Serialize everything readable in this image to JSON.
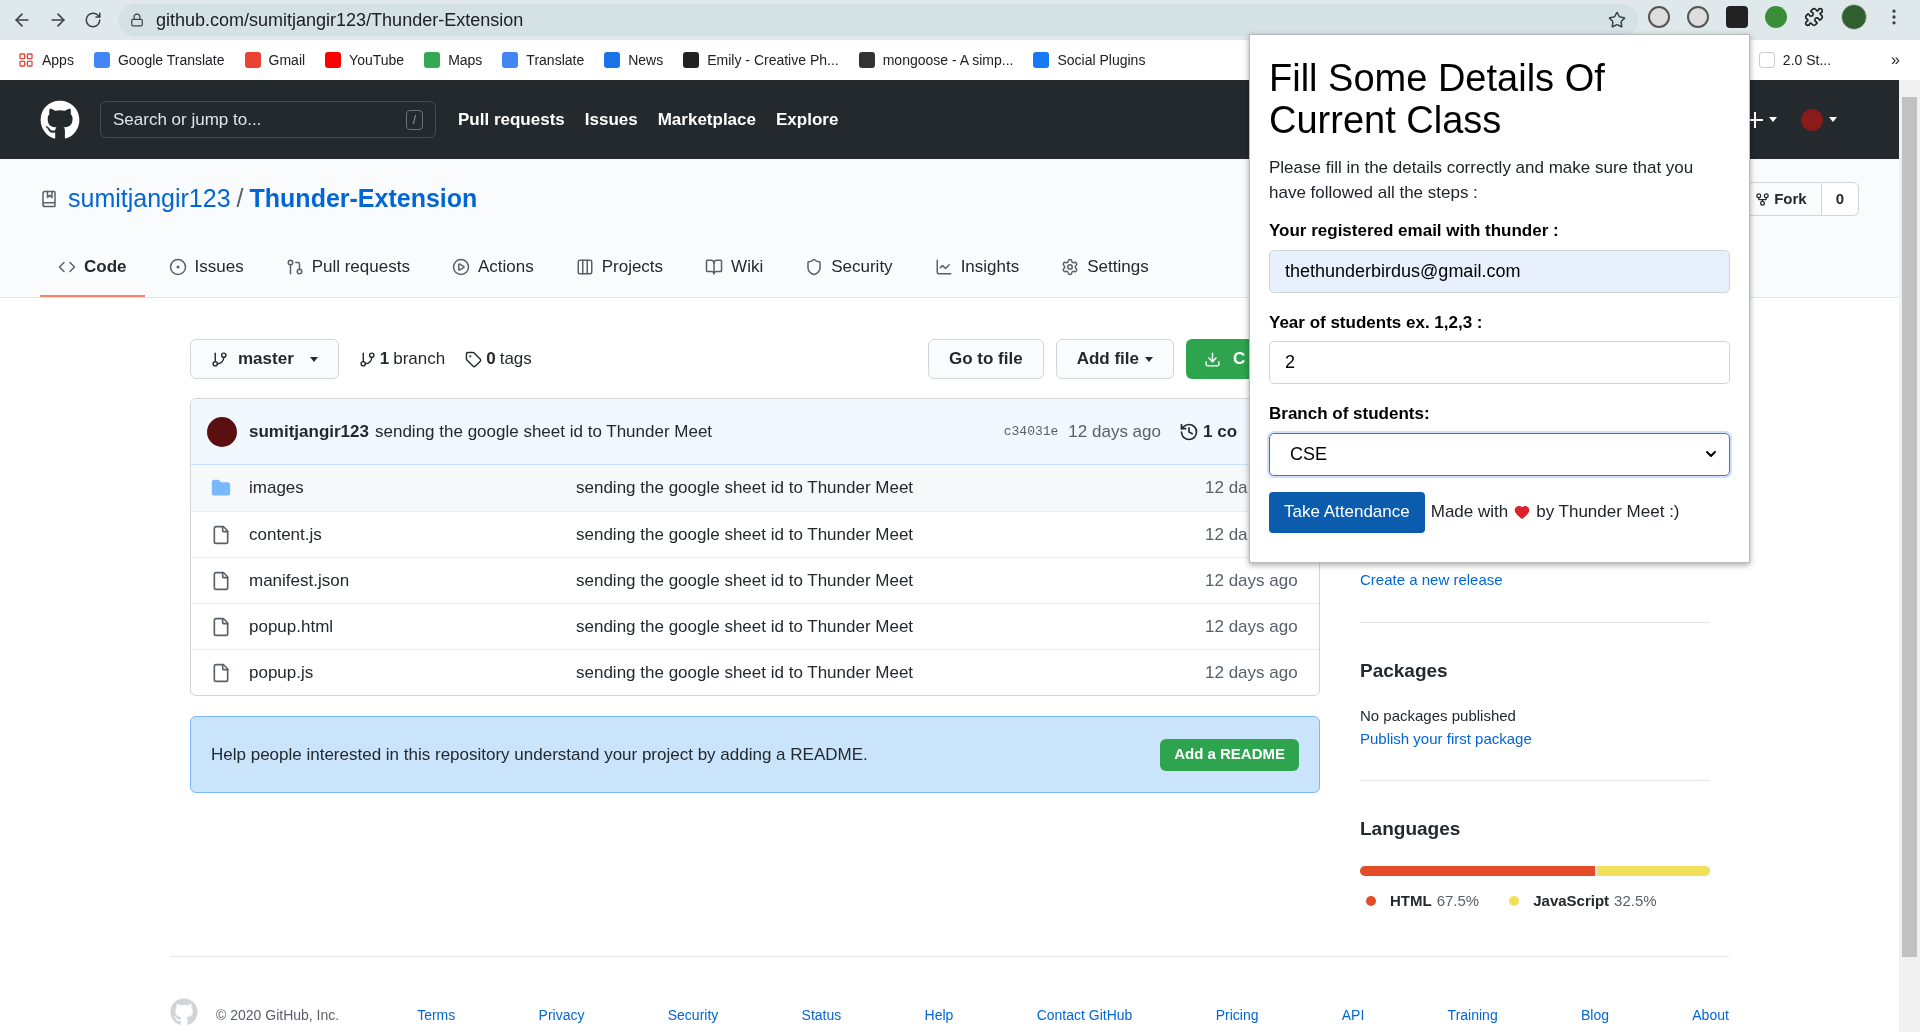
{
  "browser": {
    "url": "github.com/sumitjangir123/Thunder-Extension",
    "bookmarks": [
      {
        "kind": "apps",
        "label": "Apps",
        "color": "#e8453c"
      },
      {
        "kind": "site",
        "label": "Google Translate",
        "color": "#4285f4"
      },
      {
        "kind": "site",
        "label": "Gmail",
        "color": "#ea4335"
      },
      {
        "kind": "site",
        "label": "YouTube",
        "color": "#ff0000"
      },
      {
        "kind": "site",
        "label": "Maps",
        "color": "#34a853"
      },
      {
        "kind": "site",
        "label": "Translate",
        "color": "#4285f4"
      },
      {
        "kind": "site",
        "label": "News",
        "color": "#1a73e8"
      },
      {
        "kind": "site",
        "label": "Emily - Creative Ph...",
        "color": "#222222"
      },
      {
        "kind": "site",
        "label": "mongoose - A simp...",
        "color": "#333333"
      },
      {
        "kind": "site",
        "label": "Social Plugins",
        "color": "#1877f2"
      },
      {
        "kind": "site",
        "label": "2.0 St...",
        "color": "#ffffff"
      }
    ],
    "overflow": "»"
  },
  "github_header": {
    "search_placeholder": "Search or jump to...",
    "shortcut": "/",
    "nav": [
      "Pull requests",
      "Issues",
      "Marketplace",
      "Explore"
    ]
  },
  "repo": {
    "owner": "sumitjangir123",
    "separator": "/",
    "name": "Thunder-Extension",
    "fork_label": "Fork",
    "fork_count": "0"
  },
  "tabs": [
    {
      "label": "Code",
      "selected": true
    },
    {
      "label": "Issues",
      "selected": false
    },
    {
      "label": "Pull requests",
      "selected": false
    },
    {
      "label": "Actions",
      "selected": false
    },
    {
      "label": "Projects",
      "selected": false
    },
    {
      "label": "Wiki",
      "selected": false
    },
    {
      "label": "Security",
      "selected": false
    },
    {
      "label": "Insights",
      "selected": false
    },
    {
      "label": "Settings",
      "selected": false
    }
  ],
  "branch_bar": {
    "branch": "master",
    "branch_count": "1",
    "branch_label": "branch",
    "tag_count": "0",
    "tag_label": "tags",
    "go_to_file": "Go to file",
    "add_file": "Add file",
    "code": "C"
  },
  "commit": {
    "author": "sumitjangir123",
    "message": "sending the google sheet id to Thunder Meet",
    "sha": "c34031e",
    "time": "12 days ago",
    "count": "1 co"
  },
  "files": [
    {
      "kind": "folder",
      "name": "images",
      "message": "sending the google sheet id to Thunder Meet",
      "time": "12 da"
    },
    {
      "kind": "file",
      "name": "content.js",
      "message": "sending the google sheet id to Thunder Meet",
      "time": "12 da"
    },
    {
      "kind": "file",
      "name": "manifest.json",
      "message": "sending the google sheet id to Thunder Meet",
      "time": "12 days ago"
    },
    {
      "kind": "file",
      "name": "popup.html",
      "message": "sending the google sheet id to Thunder Meet",
      "time": "12 days ago"
    },
    {
      "kind": "file",
      "name": "popup.js",
      "message": "sending the google sheet id to Thunder Meet",
      "time": "12 days ago"
    }
  ],
  "readme_banner": {
    "text": "Help people interested in this repository understand your project by adding a README.",
    "button": "Add a README"
  },
  "sidebar": {
    "release_link": "Create a new release",
    "packages": {
      "title": "Packages",
      "text": "No packages published",
      "link": "Publish your first package"
    },
    "languages": {
      "title": "Languages",
      "items": [
        {
          "name": "HTML",
          "percent": "67.5%",
          "color": "#e34c26",
          "level": 0.675
        },
        {
          "name": "JavaScript",
          "percent": "32.5%",
          "color": "#f1e05a",
          "level": 0.325
        }
      ]
    }
  },
  "footer": {
    "copyright": "© 2020 GitHub, Inc.",
    "links": [
      "Terms",
      "Privacy",
      "Security",
      "Status",
      "Help",
      "Contact GitHub",
      "Pricing",
      "API",
      "Training",
      "Blog",
      "About"
    ]
  },
  "popup": {
    "title": "Fill Some Details Of Current Class",
    "description": "Please fill in the details correctly and make sure that you have followed all the steps :",
    "email_label": "Your registered email with thunder :",
    "email_value": "thethunderbirdus@gmail.com",
    "year_label": "Year of students ex. 1,2,3 :",
    "year_value": "2",
    "branch_label": "Branch of students:",
    "branch_value": "CSE",
    "branch_focused": true,
    "button": "Take Attendance",
    "credit_before": "Made with",
    "credit_after": "by Thunder Meet :)"
  }
}
